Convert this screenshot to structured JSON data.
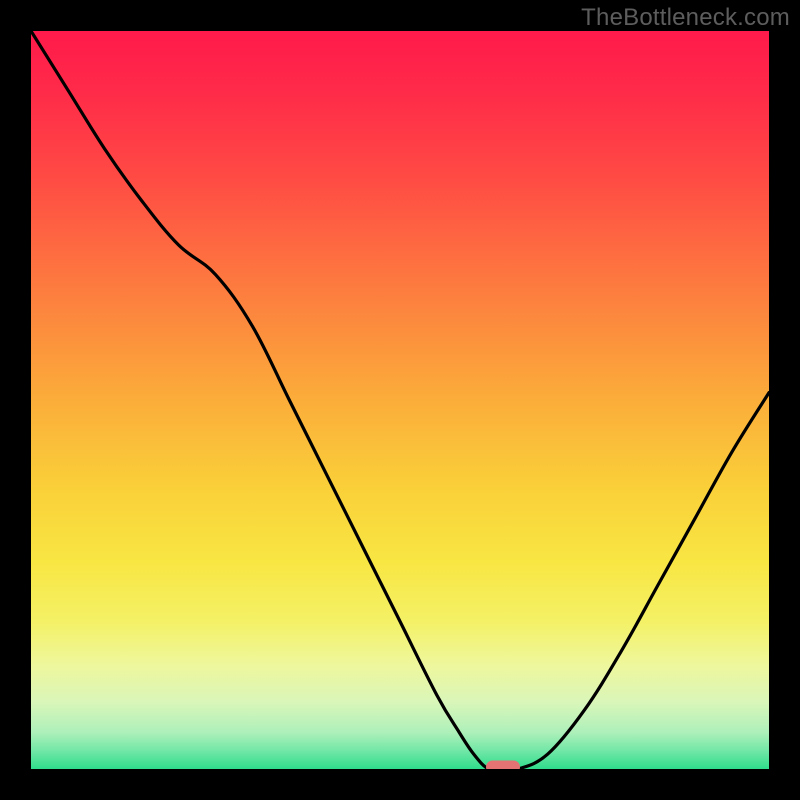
{
  "watermark": "TheBottleneck.com",
  "chart_data": {
    "type": "line",
    "title": "",
    "xlabel": "",
    "ylabel": "",
    "xlim": [
      0,
      100
    ],
    "ylim": [
      0,
      100
    ],
    "x": [
      0,
      5,
      10,
      15,
      20,
      25,
      30,
      35,
      40,
      45,
      50,
      55,
      58,
      60,
      62,
      64,
      66,
      70,
      75,
      80,
      85,
      90,
      95,
      100
    ],
    "values": [
      100,
      92,
      84,
      77,
      71,
      67,
      60,
      50,
      40,
      30,
      20,
      10,
      5,
      2,
      0,
      0,
      0,
      2,
      8,
      16,
      25,
      34,
      43,
      51
    ],
    "marker": {
      "x": 64,
      "y": 0
    },
    "gradient_stops": [
      {
        "offset": 0.0,
        "color": "#ff1a4b"
      },
      {
        "offset": 0.08,
        "color": "#ff2a49"
      },
      {
        "offset": 0.2,
        "color": "#ff4b44"
      },
      {
        "offset": 0.35,
        "color": "#fd7c3f"
      },
      {
        "offset": 0.5,
        "color": "#fbad3a"
      },
      {
        "offset": 0.62,
        "color": "#fad039"
      },
      {
        "offset": 0.72,
        "color": "#f8e643"
      },
      {
        "offset": 0.8,
        "color": "#f4f166"
      },
      {
        "offset": 0.86,
        "color": "#eef79d"
      },
      {
        "offset": 0.91,
        "color": "#d9f6b9"
      },
      {
        "offset": 0.95,
        "color": "#aef0ba"
      },
      {
        "offset": 0.975,
        "color": "#72e7a7"
      },
      {
        "offset": 1.0,
        "color": "#2fdc8b"
      }
    ]
  }
}
